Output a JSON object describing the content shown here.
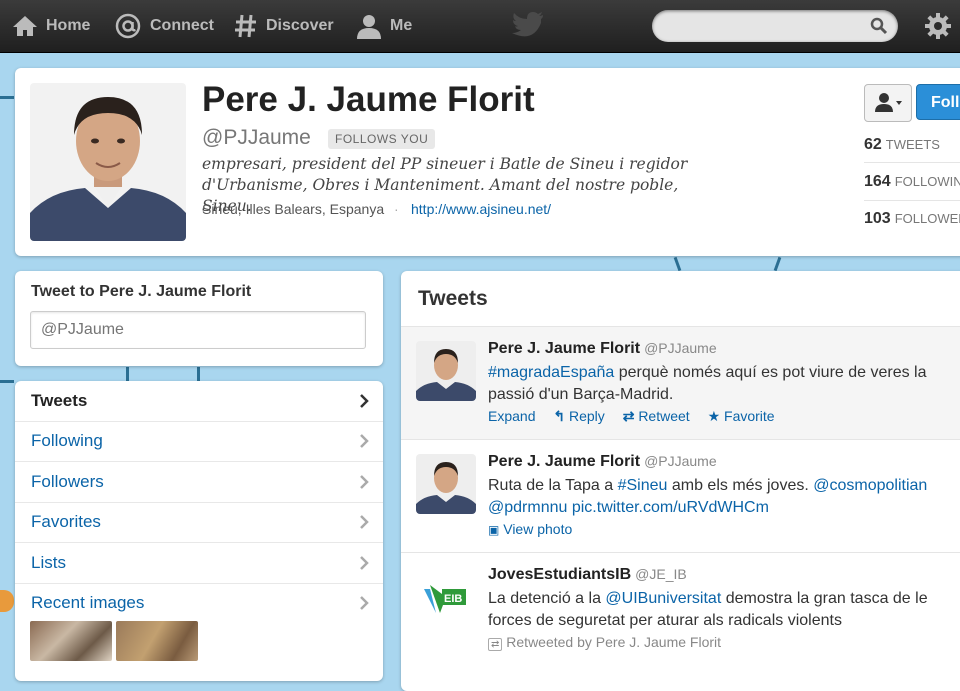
{
  "topnav": {
    "home": "Home",
    "connect": "Connect",
    "discover": "Discover",
    "me": "Me",
    "search_placeholder": ""
  },
  "profile": {
    "name": "Pere J. Jaume Florit",
    "handle": "@PJJaume",
    "follows_you": "FOLLOWS YOU",
    "bio_line1": "empresari, president del PP sineuer i Batle de Sineu i regidor",
    "bio_line2": "d'Urbanisme, Obres i Manteniment. Amant del nostre poble, Sineu.",
    "location": "Sineu, Illes Balears, Espanya",
    "separator": "·",
    "url": "http://www.ajsineu.net/",
    "follow_label": "Follow",
    "stats": [
      {
        "count": "62",
        "label": "TWEETS"
      },
      {
        "count": "164",
        "label": "FOLLOWING"
      },
      {
        "count": "103",
        "label": "FOLLOWERS"
      }
    ]
  },
  "tweet_to": {
    "title": "Tweet to Pere J. Jaume Florit",
    "placeholder": "@PJJaume"
  },
  "sidebar": {
    "items": [
      {
        "label": "Tweets",
        "active": true
      },
      {
        "label": "Following"
      },
      {
        "label": "Followers"
      },
      {
        "label": "Favorites"
      },
      {
        "label": "Lists"
      },
      {
        "label": "Recent images"
      }
    ]
  },
  "timeline": {
    "title": "Tweets",
    "tweets": [
      {
        "name": "Pere J. Jaume Florit",
        "handle": "@PJJaume",
        "hashtag": "#magradaEspaña",
        "text1_rest": " perquè només aquí es pot viure de veres la",
        "text2": "passió d'un Barça-Madrid.",
        "expand": "Expand",
        "reply": "Reply",
        "retweet": "Retweet",
        "favorite": "Favorite"
      },
      {
        "name": "Pere J. Jaume Florit",
        "handle": "@PJJaume",
        "text1_a": "Ruta de la Tapa a ",
        "hashtag": "#Sineu",
        "text1_b": " amb els més joves. ",
        "mention": "@cosmopolitian",
        "mention2": "@pdrmnnu",
        "pic": "pic.twitter.com/uRVdWHCm",
        "view_photo": "View photo"
      },
      {
        "name": "JovesEstudiantsIB",
        "handle": "@JE_IB",
        "avatar_text": "EIB",
        "text1_a": "La detenció a la ",
        "mention": "@UIBuniversitat",
        "text1_b": " demostra la gran tasca de le",
        "text2": "forces de seguretat per aturar als radicals violents",
        "retweeted_by": "Retweeted by Pere J. Jaume Florit"
      }
    ]
  },
  "colors": {
    "link": "#0b64a8",
    "follow_button": "#2b8fd8",
    "background": "#a9d6ef"
  }
}
